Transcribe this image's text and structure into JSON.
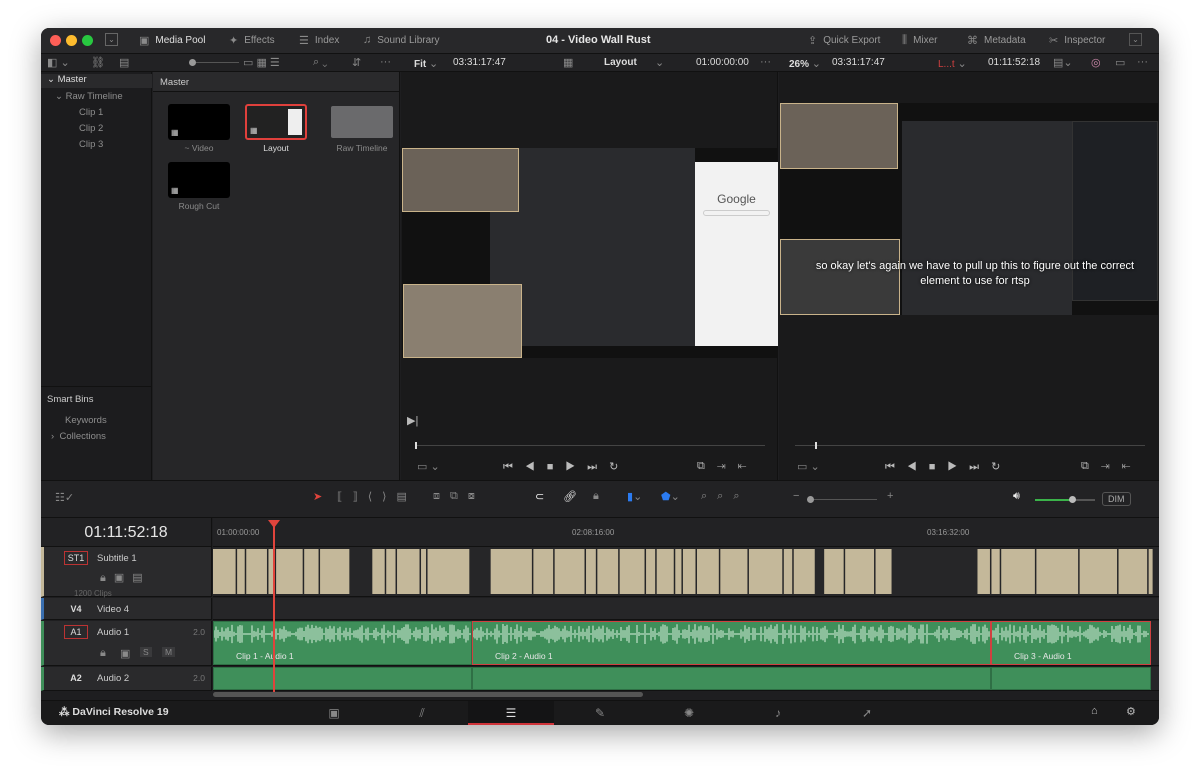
{
  "window": {
    "title": "04 - Video Wall Rust"
  },
  "toolbar": {
    "left": [
      {
        "icon": "media-pool-icon",
        "label": "Media Pool",
        "active": true
      },
      {
        "icon": "effects-icon",
        "label": "Effects"
      },
      {
        "icon": "index-icon",
        "label": "Index"
      },
      {
        "icon": "sound-library-icon",
        "label": "Sound Library"
      }
    ],
    "right": [
      {
        "icon": "quick-export-icon",
        "label": "Quick Export"
      },
      {
        "icon": "mixer-icon",
        "label": "Mixer"
      },
      {
        "icon": "metadata-icon",
        "label": "Metadata"
      },
      {
        "icon": "inspector-icon",
        "label": "Inspector"
      }
    ]
  },
  "source_viewer": {
    "zoom": "Fit",
    "duration": "03:31:17:47",
    "clip": "Layout",
    "timecode": "01:00:00:00"
  },
  "program_viewer": {
    "zoom": "26%",
    "duration": "03:31:17:47",
    "track": "L...t",
    "timecode": "01:11:52:18",
    "caption": "so okay let's again we have to pull up this to figure out the correct element to use for rtsp"
  },
  "bins": {
    "root": "Master",
    "items": [
      {
        "label": "Raw Timeline"
      },
      {
        "label": "Clip 1"
      },
      {
        "label": "Clip 2"
      },
      {
        "label": "Clip 3"
      }
    ],
    "smart_bins": "Smart Bins",
    "smart_items": [
      {
        "label": "Keywords"
      },
      {
        "label": "Collections"
      }
    ]
  },
  "clips": {
    "header": "Master",
    "items": [
      {
        "label": "~ Video"
      },
      {
        "label": "Layout"
      },
      {
        "label": "Raw Timeline"
      },
      {
        "label": "Rough Cut"
      }
    ]
  },
  "timeline": {
    "timecode": "01:11:52:18",
    "ruler": [
      "01:00:00:00",
      "02:08:16:00",
      "03:16:32:00"
    ],
    "dim": "DIM",
    "tracks": [
      {
        "id": "ST1",
        "name": "Subtitle 1",
        "info": "1200 Clips"
      },
      {
        "id": "V4",
        "name": "Video 4"
      },
      {
        "id": "A1",
        "name": "Audio 1",
        "channels": "2.0",
        "solo": "S",
        "mute": "M"
      },
      {
        "id": "A2",
        "name": "Audio 2",
        "channels": "2.0"
      }
    ],
    "audio_clips": [
      "Clip 1 - Audio 1",
      "Clip 2 - Audio 1",
      "Clip 3 - Audio 1"
    ]
  },
  "app": {
    "name": "DaVinci Resolve 19"
  },
  "colors": {
    "accent": "#d0343a",
    "audio": "#3f8f5a",
    "subtitle": "#c4b89a"
  }
}
